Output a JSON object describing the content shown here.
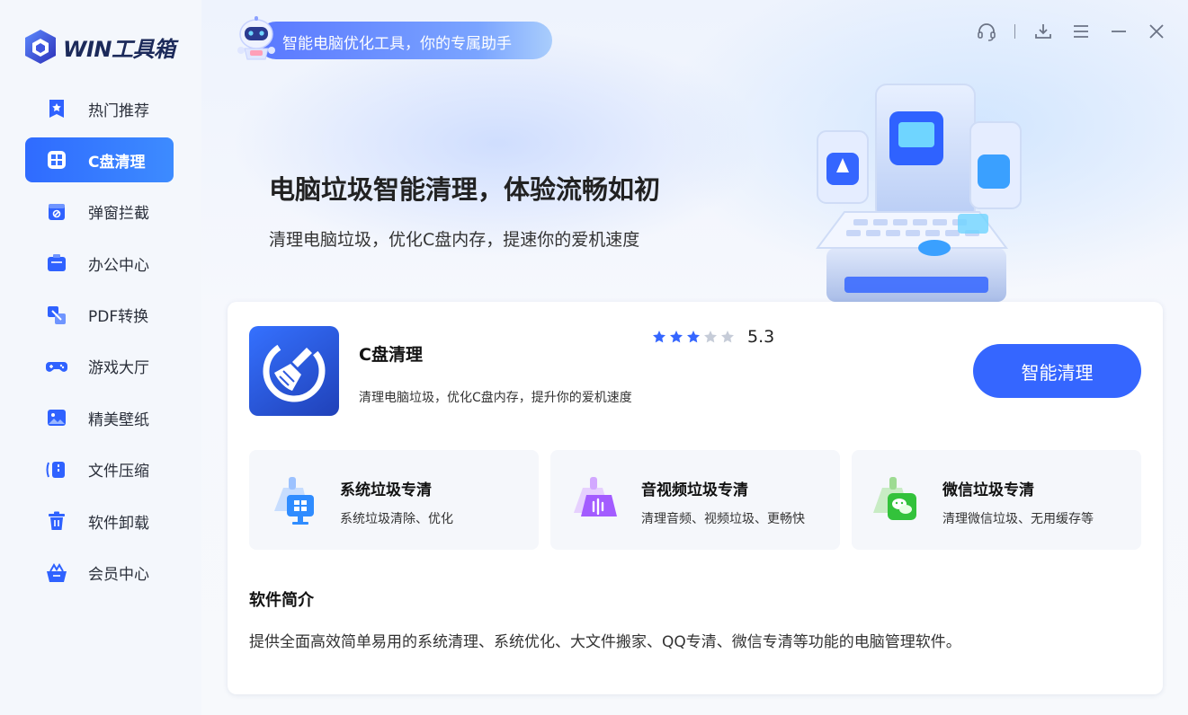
{
  "app": {
    "logo_text": "WIN工具箱"
  },
  "sidebar": {
    "items": [
      {
        "label": "热门推荐",
        "icon": "bookmark-star-icon"
      },
      {
        "label": "C盘清理",
        "icon": "grid-icon",
        "active": true
      },
      {
        "label": "弹窗拦截",
        "icon": "popup-block-icon"
      },
      {
        "label": "办公中心",
        "icon": "briefcase-icon"
      },
      {
        "label": "PDF转换",
        "icon": "pdf-convert-icon"
      },
      {
        "label": "游戏大厅",
        "icon": "gamepad-icon"
      },
      {
        "label": "精美壁纸",
        "icon": "image-icon"
      },
      {
        "label": "文件压缩",
        "icon": "compress-icon"
      },
      {
        "label": "软件卸载",
        "icon": "trash-icon"
      },
      {
        "label": "会员中心",
        "icon": "crown-basket-icon"
      }
    ]
  },
  "banner": {
    "slogan": "智能电脑优化工具，你的专属助手",
    "title": "电脑垃圾智能清理，体验流畅如初",
    "subtitle": "清理电脑垃圾，优化C盘内存，提速你的爱机速度"
  },
  "window_controls": [
    "headset-icon",
    "download-icon",
    "menu-icon",
    "minimize-icon",
    "close-icon"
  ],
  "card": {
    "name": "C盘清理",
    "description": "清理电脑垃圾，优化C盘内存，提升你的爱机速度",
    "rating_value": "5.3",
    "stars_filled": 3,
    "stars_total": 5,
    "action_label": "智能清理",
    "features": [
      {
        "title": "系统垃圾专清",
        "desc": "系统垃圾清除、优化",
        "icon": "system-broom-icon"
      },
      {
        "title": "音视频垃圾专清",
        "desc": "清理音频、视频垃圾、更畅快",
        "icon": "media-broom-icon"
      },
      {
        "title": "微信垃圾专清",
        "desc": "清理微信垃圾、无用缓存等",
        "icon": "wechat-broom-icon"
      }
    ],
    "intro_title": "软件简介",
    "intro_text": "提供全面高效简单易用的系统清理、系统优化、大文件搬家、QQ专清、微信专清等功能的电脑管理软件。"
  },
  "colors": {
    "accent": "#3566ff",
    "sidebar_bg": "#f4f7fc",
    "text": "#222222"
  }
}
